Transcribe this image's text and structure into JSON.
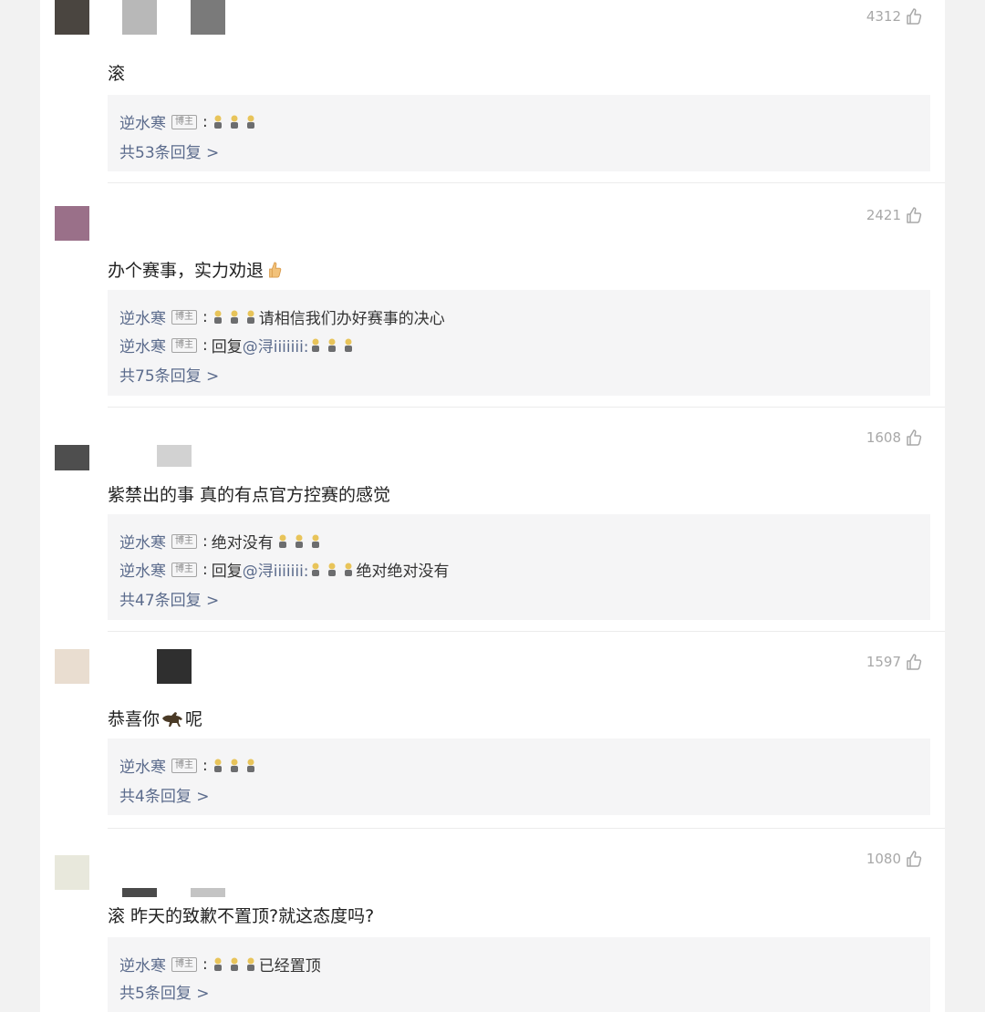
{
  "colors": {
    "author": "#5b6b8c",
    "likes": "#a8a8a8",
    "reply_bg": "#f5f5f6"
  },
  "badge_label": "博主",
  "author_name": "逆水寒",
  "icons": {
    "like": "thumbs-up-icon",
    "reply_emoji": "trophy-figure-emoji",
    "thumb_emoji": "thumbs-up-emoji",
    "horse_emoji": "horse-emoji"
  },
  "comments": [
    {
      "likes": "4312",
      "text": "滚",
      "replies": [
        {
          "prefix": "",
          "suffix": ""
        }
      ],
      "reply_count": "共53条回复 >"
    },
    {
      "likes": "2421",
      "text": "办个赛事，实力劝退",
      "replies": [
        {
          "prefix": "",
          "suffix": "请相信我们办好赛事的决心"
        },
        {
          "prefix": "回复",
          "mention": "@浔iiiiiii:",
          "suffix": ""
        }
      ],
      "reply_count": "共75条回复 >"
    },
    {
      "likes": "1608",
      "text": "紫禁出的事 真的有点官方控赛的感觉",
      "replies": [
        {
          "prefix": "绝对没有",
          "suffix": ""
        },
        {
          "prefix": "回复",
          "mention": "@浔iiiiiii:",
          "suffix": "绝对绝对没有"
        }
      ],
      "reply_count": "共47条回复 >"
    },
    {
      "likes": "1597",
      "text_before": "恭喜你",
      "text_after": "呢",
      "replies": [
        {
          "prefix": "",
          "suffix": ""
        }
      ],
      "reply_count": "共4条回复 >"
    },
    {
      "likes": "1080",
      "text": "滚  昨天的致歉不置顶?就这态度吗?",
      "replies": [
        {
          "prefix": "",
          "suffix": "已经置顶"
        }
      ],
      "reply_count": "共5条回复 >"
    }
  ]
}
